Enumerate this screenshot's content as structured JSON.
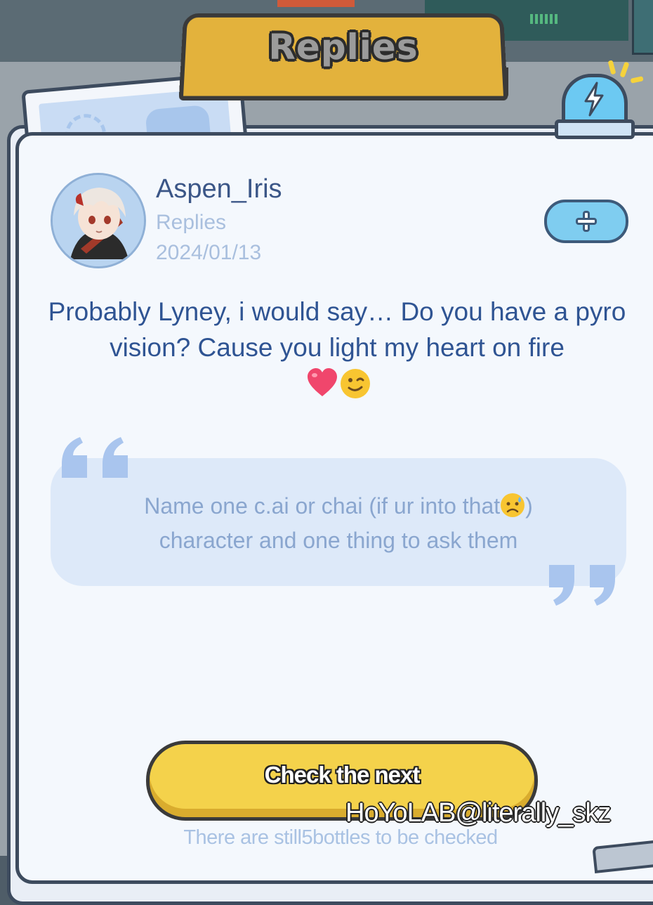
{
  "header": {
    "title": "Replies"
  },
  "post": {
    "author": "Aspen_Iris",
    "label": "Replies",
    "date": "2024/01/13",
    "reply_text": "Probably Lyney, i would say… Do you have a pyro vision? Cause you light my heart on fire",
    "reply_emojis": [
      "heart-icon",
      "wink-face-icon"
    ]
  },
  "question": {
    "line1_before_emoji": "Name one c.ai or chai (if ur into that",
    "line1_after_emoji": ")",
    "line2": "character and one thing to ask them",
    "emoji": "worried-sweat-face-icon"
  },
  "actions": {
    "next_label": "Check the next",
    "remaining_text": "There are still5bottles to be checked"
  },
  "watermark": "HoYoLAB@literally_skz",
  "colors": {
    "accent_yellow": "#f4d24b",
    "tab_gold": "#e3b23c",
    "text_blue": "#2f5493",
    "muted_blue": "#a9bfde",
    "follow_blue": "#7fcdf0"
  }
}
